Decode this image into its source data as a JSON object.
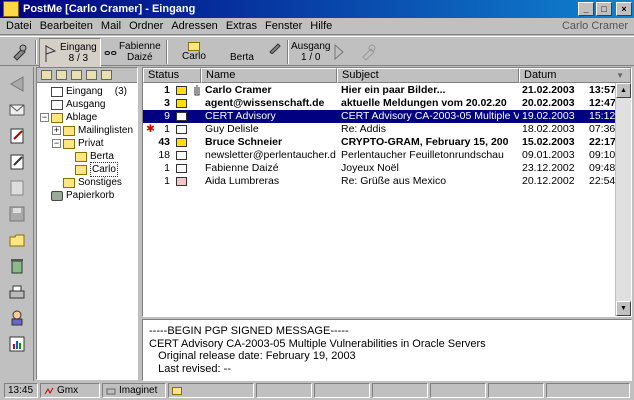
{
  "window": {
    "title": "PostMe [Carlo Cramer] - Eingang",
    "user": "Carlo Cramer"
  },
  "menu": [
    "Datei",
    "Bearbeiten",
    "Mail",
    "Ordner",
    "Adressen",
    "Extras",
    "Fenster",
    "Hilfe"
  ],
  "toolbar": {
    "mailboxes": [
      {
        "name": "Eingang",
        "count": "8 / 3"
      },
      {
        "name": "Fabienne",
        "sub": "Daizé"
      },
      {
        "name": "Carlo"
      },
      {
        "name": "Berta"
      }
    ],
    "outbox": {
      "name": "Ausgang",
      "count": "1 / 0"
    }
  },
  "tree": {
    "items": [
      {
        "label": "Eingang",
        "count": "(3)"
      },
      {
        "label": "Ausgang"
      },
      {
        "label": "Ablage"
      },
      {
        "label": "Mailinglisten"
      },
      {
        "label": "Privat"
      },
      {
        "label": "Berta"
      },
      {
        "label": "Carlo"
      },
      {
        "label": "Sonstiges"
      },
      {
        "label": "Papierkorb"
      }
    ]
  },
  "columns": {
    "status": "Status",
    "name": "Name",
    "subject": "Subject",
    "date": "Datum"
  },
  "messages": [
    {
      "count": "1",
      "name": "Carlo Cramer",
      "subject": "Hier ein paar Bilder...",
      "date": "21.02.2003",
      "time": "13:57"
    },
    {
      "count": "3",
      "name": "agent@wissenschaft.de",
      "subject": "aktuelle Meldungen vom 20.02.20",
      "date": "20.02.2003",
      "time": "12:47"
    },
    {
      "count": "9",
      "name": "CERT Advisory",
      "subject": "CERT Advisory CA-2003-05 Multiple Vu",
      "date": "19.02.2003",
      "time": "15:12"
    },
    {
      "count": "1",
      "name": "Guy Delisle",
      "subject": "Re: Addis",
      "date": "18.02.2003",
      "time": "07:36"
    },
    {
      "count": "43",
      "name": "Bruce Schneier",
      "subject": "CRYPTO-GRAM, February 15, 200",
      "date": "15.02.2003",
      "time": "22:17"
    },
    {
      "count": "18",
      "name": "newsletter@perlentaucher.d",
      "subject": "Perlentaucher Feuilletonrundschau",
      "date": "09.01.2003",
      "time": "09:10"
    },
    {
      "count": "1",
      "name": "Fabienne Daizé",
      "subject": "Joyeux Noël",
      "date": "23.12.2002",
      "time": "09:48"
    },
    {
      "count": "1",
      "name": "Aida Lumbreras",
      "subject": "Re: Grüße aus Mexico",
      "date": "20.12.2002",
      "time": "22:54"
    }
  ],
  "preview": {
    "lines": [
      "-----BEGIN PGP SIGNED MESSAGE-----",
      "CERT Advisory CA-2003-05 Multiple Vulnerabilities in Oracle Servers",
      "   Original release date: February 19, 2003",
      "   Last revised: --"
    ]
  },
  "status": {
    "time": "13:45",
    "account1": "Gmx",
    "account2": "Imaginet"
  }
}
